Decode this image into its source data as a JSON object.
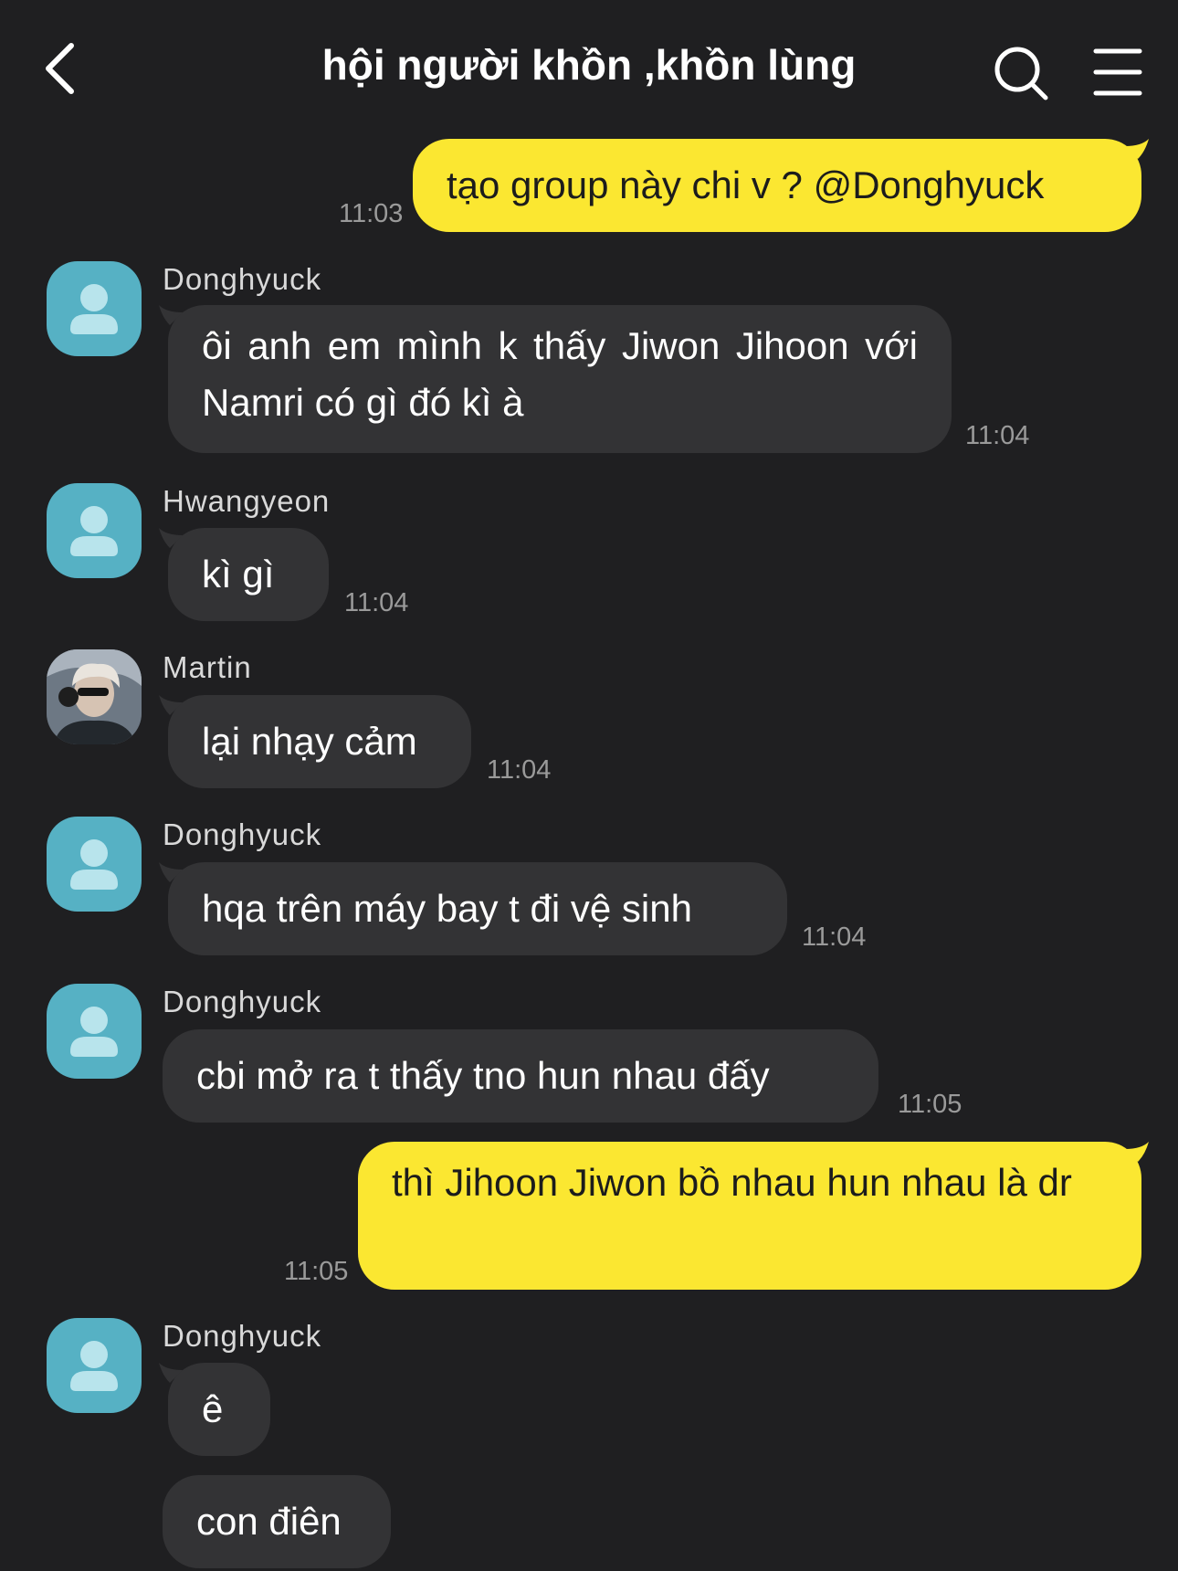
{
  "header": {
    "title": "hội người khồn ,khồn lùng"
  },
  "messages": [
    {
      "direction": "out",
      "text": "tạo group này chi v ? @Donghyuck",
      "time": "11:03"
    },
    {
      "direction": "in",
      "sender": "Donghyuck",
      "text": "ôi anh em mình k thấy Jiwon Jihoon với Namri có gì đó kì à",
      "time": "11:04"
    },
    {
      "direction": "in",
      "sender": "Hwangyeon",
      "text": "kì gì",
      "time": "11:04"
    },
    {
      "direction": "in",
      "sender": "Martin",
      "text": "lại nhạy cảm",
      "time": "11:04"
    },
    {
      "direction": "in",
      "sender": "Donghyuck",
      "text": "hqa trên máy bay t đi vệ sinh",
      "time": "11:04"
    },
    {
      "direction": "in",
      "sender": "Donghyuck",
      "text": "cbi mở ra t thấy tno hun nhau đấy",
      "time": "11:05"
    },
    {
      "direction": "out",
      "text": "thì Jihoon Jiwon bồ nhau hun nhau là dr",
      "time": "11:05"
    },
    {
      "direction": "in",
      "sender": "Donghyuck",
      "text": "ê"
    },
    {
      "direction": "in",
      "text": "con điên"
    }
  ],
  "colors": {
    "background": "#1f1f21",
    "incoming_bubble": "#333335",
    "outgoing_bubble": "#fbe731",
    "avatar": "#56b1c4"
  },
  "icons": {
    "back": "chevron-left-icon",
    "search": "search-icon",
    "menu": "hamburger-menu-icon",
    "avatar": "default-person-icon"
  }
}
